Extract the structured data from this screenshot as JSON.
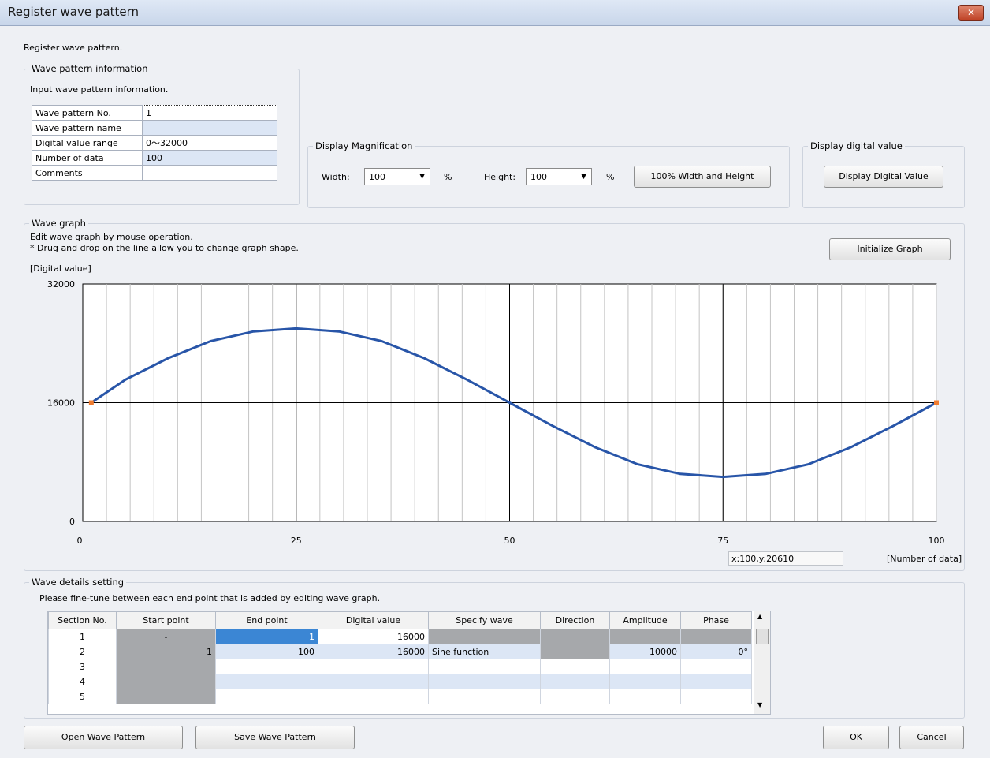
{
  "window": {
    "title": "Register wave pattern",
    "close_glyph": "✕"
  },
  "header": {
    "description": "Register wave pattern."
  },
  "wave_info": {
    "legend": "Wave pattern information",
    "description": "Input wave pattern information.",
    "rows": [
      {
        "label": "Wave pattern No.",
        "value": "1"
      },
      {
        "label": "Wave pattern name",
        "value": ""
      },
      {
        "label": "Digital value range",
        "value": "0～32000"
      },
      {
        "label": "Number of data",
        "value": "100"
      },
      {
        "label": "Comments",
        "value": ""
      }
    ]
  },
  "magnification": {
    "legend": "Display Magnification",
    "width_label": "Width:",
    "width_value": "100",
    "width_unit": "%",
    "height_label": "Height:",
    "height_value": "100",
    "height_unit": "%",
    "reset_button": "100% Width and Height"
  },
  "digital_display": {
    "legend": "Display digital value",
    "button": "Display Digital Value"
  },
  "wave_graph": {
    "legend": "Wave graph",
    "description_1": "Edit wave graph by  mouse operation.",
    "description_2": "* Drug and drop on the line allow you to change graph shape.",
    "initialize_button": "Initialize Graph",
    "y_label": "[Digital value]",
    "x_label": "[Number of data]",
    "cursor_readout": "x:100,y:20610"
  },
  "chart_data": {
    "type": "line",
    "xlabel": "[Number of data]",
    "ylabel": "[Digital value]",
    "xlim": [
      0,
      100
    ],
    "ylim": [
      0,
      32000
    ],
    "x_ticks": [
      "0",
      "25",
      "50",
      "75",
      "100"
    ],
    "y_ticks": [
      "0",
      "16000",
      "32000"
    ],
    "series": [
      {
        "x": [
          1,
          5,
          10,
          15,
          20,
          25,
          30,
          35,
          40,
          45,
          50,
          55,
          60,
          65,
          70,
          75,
          80,
          85,
          90,
          95,
          100
        ],
        "y": [
          16000,
          19100,
          22000,
          24300,
          25600,
          26000,
          25600,
          24300,
          22000,
          19100,
          16000,
          12900,
          10000,
          7700,
          6400,
          6000,
          6400,
          7700,
          10000,
          12900,
          16000
        ]
      }
    ],
    "end_points": [
      {
        "x": 1,
        "y": 16000
      },
      {
        "x": 100,
        "y": 16000
      }
    ],
    "colors": {
      "line": "#2855a8",
      "end_point": "#f07c30"
    }
  },
  "details": {
    "legend": "Wave details setting",
    "description": "Please fine-tune between each end point that is added by editing wave graph.",
    "columns": [
      "Section No.",
      "Start point",
      "End point",
      "Digital value",
      "Specify wave",
      "Direction",
      "Amplitude",
      "Phase"
    ],
    "rows": [
      {
        "section": "1",
        "start": "-",
        "end": "1",
        "digital": "16000",
        "wave": "",
        "direction": "",
        "amplitude": "",
        "phase": ""
      },
      {
        "section": "2",
        "start": "1",
        "end": "100",
        "digital": "16000",
        "wave": "Sine function",
        "direction": "",
        "amplitude": "10000",
        "phase": "0°"
      },
      {
        "section": "3",
        "start": "",
        "end": "",
        "digital": "",
        "wave": "",
        "direction": "",
        "amplitude": "",
        "phase": ""
      },
      {
        "section": "4",
        "start": "",
        "end": "",
        "digital": "",
        "wave": "",
        "direction": "",
        "amplitude": "",
        "phase": ""
      },
      {
        "section": "5",
        "start": "",
        "end": "",
        "digital": "",
        "wave": "",
        "direction": "",
        "amplitude": "",
        "phase": ""
      }
    ]
  },
  "footer": {
    "open_button": "Open Wave Pattern",
    "save_button": "Save Wave Pattern",
    "ok_button": "OK",
    "cancel_button": "Cancel"
  }
}
